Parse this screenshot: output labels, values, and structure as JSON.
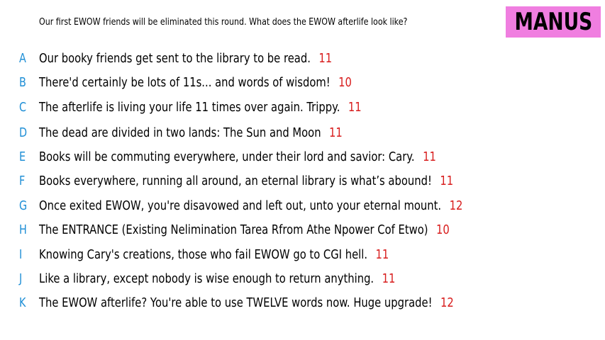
{
  "prompt": "Our first EWOW friends will be eliminated this round. What does the EWOW afterlife look like?",
  "badge": {
    "label": "MANUS",
    "color": "#f07ee0"
  },
  "colors": {
    "letter": "#1f8fd6",
    "score": "#d81e1e"
  },
  "responses": [
    {
      "letter": "A",
      "text": "Our booky friends get sent to the library to be read.",
      "score": "11"
    },
    {
      "letter": "B",
      "text": "There'd certainly be lots of 11s... and words of wisdom!",
      "score": "10"
    },
    {
      "letter": "C",
      "text": "The afterlife is living your life 11 times over again. Trippy.",
      "score": "11"
    },
    {
      "letter": "D",
      "text": "The dead are divided in two lands: The Sun and Moon",
      "score": "11"
    },
    {
      "letter": "E",
      "text": "Books will be commuting everywhere, under their lord and savior: Cary.",
      "score": "11"
    },
    {
      "letter": "F",
      "text": "Books everywhere, running all around, an eternal library is what’s abound!",
      "score": "11"
    },
    {
      "letter": "G",
      "text": "Once exited EWOW, you're disavowed and left out, unto your eternal mount.",
      "score": "12"
    },
    {
      "letter": "H",
      "text": "The ENTRANCE (Existing Nelimination Tarea Rfrom Athe Npower Cof Etwo)",
      "score": "10"
    },
    {
      "letter": "I",
      "text": "Knowing Cary's creations, those who fail EWOW go to CGI hell.",
      "score": "11"
    },
    {
      "letter": "J",
      "text": "Like a library, except nobody is wise enough to return anything.",
      "score": "11"
    },
    {
      "letter": "K",
      "text": "The EWOW afterlife? You're able to use TWELVE words now. Huge upgrade!",
      "score": "12"
    }
  ]
}
